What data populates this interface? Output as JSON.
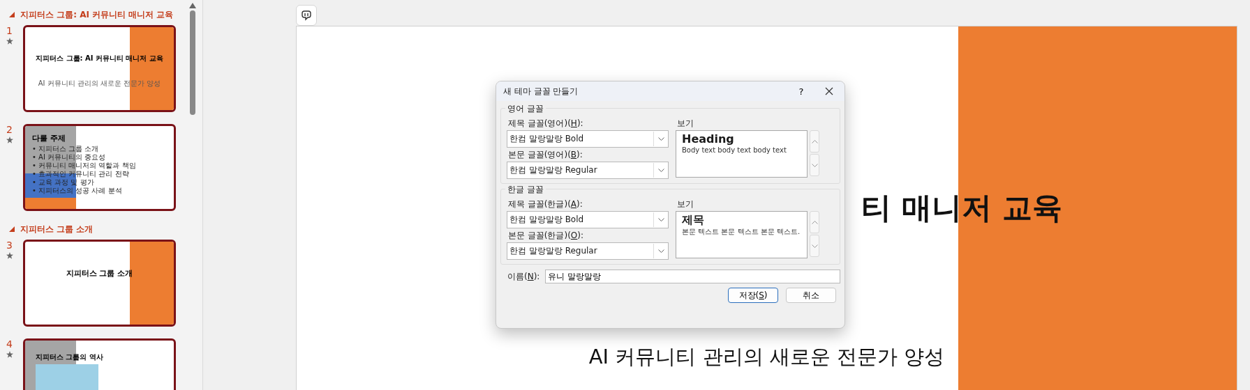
{
  "slide_panel": {
    "sections": [
      {
        "title": "지피터스 그룹: AI 커뮤니티 매니저 교육",
        "expanded": true,
        "slides": [
          {
            "number": "1",
            "selected": true,
            "kind": "title",
            "title": "지피터스 그룹: AI 커뮤니티 매니저 교육",
            "subtitle": "AI 커뮤니티 관리의 새로운 전문가 양성"
          },
          {
            "number": "2",
            "selected": true,
            "kind": "agenda",
            "title": "다룰 주제",
            "bullets": [
              "• 지피터스 그룹 소개",
              "• AI 커뮤니티의 중요성",
              "• 커뮤니티 매니저의 역할과 책임",
              "• 효과적인 커뮤니티 관리 전략",
              "• 교육 과정 및 평가",
              "• 지피터스의 성공 사례 분석"
            ]
          }
        ]
      },
      {
        "title": "지피터스 그룹 소개",
        "expanded": true,
        "slides": [
          {
            "number": "3",
            "selected": true,
            "kind": "section",
            "title": "지피터스 그룹 소개"
          },
          {
            "number": "4",
            "selected": true,
            "kind": "history",
            "title": "지피터스 그룹의 역사"
          }
        ]
      }
    ]
  },
  "slide": {
    "title": "티 매니저 교육",
    "subtitle": "AI 커뮤니티 관리의 새로운 전문가 양성"
  },
  "dialog": {
    "title": "새 테마 글꼴 만들기",
    "help": "?",
    "groups": [
      {
        "title": "영어 글꼴",
        "fields": [
          {
            "label": "제목 글꼴(영어)(",
            "key": "H",
            "label_end": "):",
            "value": "한컴 말랑말랑 Bold"
          },
          {
            "label": "본문 글꼴(영어)(",
            "key": "B",
            "label_end": "):",
            "value": "한컴 말랑말랑 Regular"
          }
        ],
        "preview_label": "보기",
        "preview_heading": "Heading",
        "preview_body": "Body text body text body text"
      },
      {
        "title": "한글 글꼴",
        "fields": [
          {
            "label": "제목 글꼴(한글)(",
            "key": "A",
            "label_end": "):",
            "value": "한컴 말랑말랑 Bold"
          },
          {
            "label": "본문 글꼴(한글)(",
            "key": "O",
            "label_end": "):",
            "value": "한컴 말랑말랑 Regular"
          }
        ],
        "preview_label": "보기",
        "preview_heading": "제목",
        "preview_body": "본문 텍스트 본문 텍스트 본문 텍스트."
      }
    ],
    "name_field": {
      "label": "이름(",
      "key": "N",
      "label_end": "):",
      "value": "유니 말랑말랑"
    },
    "buttons": [
      {
        "label": "저장(",
        "key": "S",
        "label_end": ")",
        "default": true
      },
      {
        "label": "취소",
        "default": false
      }
    ]
  }
}
